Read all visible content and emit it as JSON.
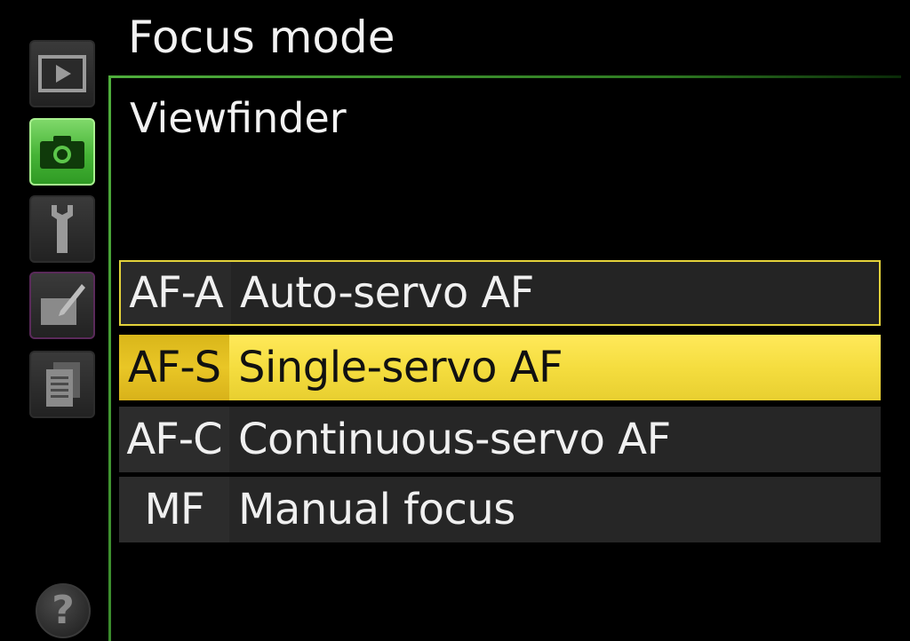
{
  "menu": {
    "title": "Focus mode",
    "subtitle": "Viewfinder"
  },
  "sidebar": {
    "tabs": [
      {
        "icon": "playback-icon",
        "active": false
      },
      {
        "icon": "camera-icon",
        "active": true
      },
      {
        "icon": "wrench-icon",
        "active": false
      },
      {
        "icon": "retouch-icon",
        "active": false
      },
      {
        "icon": "recent-settings-icon",
        "active": false
      }
    ],
    "help_label": "?"
  },
  "options": [
    {
      "code": "AF-A",
      "label": "Auto-servo AF",
      "state": "focused"
    },
    {
      "code": "AF-S",
      "label": "Single-servo AF",
      "state": "selected"
    },
    {
      "code": "AF-C",
      "label": "Continuous-servo AF",
      "state": "normal"
    },
    {
      "code": "MF",
      "label": "Manual focus",
      "state": "normal"
    }
  ],
  "colors": {
    "accent_green": "#46b436",
    "highlight_yellow": "#f5dd3f",
    "focus_border": "#e3d23a",
    "background": "#000000"
  }
}
